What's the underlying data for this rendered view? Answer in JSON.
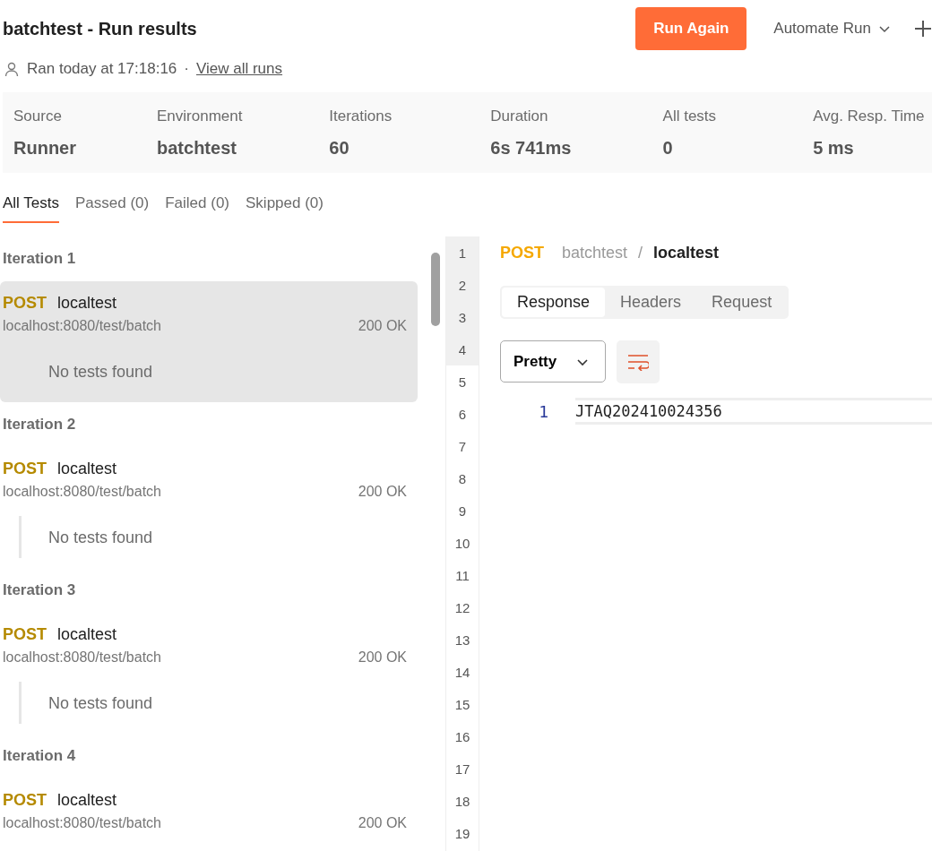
{
  "header": {
    "title": "batchtest - Run results",
    "run_again": "Run Again",
    "automate_run": "Automate Run",
    "ran_at": "Ran today at 17:18:16",
    "separator": "·",
    "view_all_runs": "View all runs"
  },
  "stats": [
    {
      "label": "Source",
      "value": "Runner"
    },
    {
      "label": "Environment",
      "value": "batchtest"
    },
    {
      "label": "Iterations",
      "value": "60"
    },
    {
      "label": "Duration",
      "value": "6s 741ms"
    },
    {
      "label": "All tests",
      "value": "0"
    },
    {
      "label": "Avg. Resp. Time",
      "value": "5 ms"
    }
  ],
  "tabs": [
    {
      "label": "All Tests",
      "selected": true
    },
    {
      "label": "Passed (0)",
      "selected": false
    },
    {
      "label": "Failed (0)",
      "selected": false
    },
    {
      "label": "Skipped (0)",
      "selected": false
    }
  ],
  "iterations": [
    {
      "title": "Iteration 1",
      "selected": true,
      "method": "POST",
      "name": "localtest",
      "url": "localhost:8080/test/batch",
      "status": "200 OK",
      "tests": "No tests found"
    },
    {
      "title": "Iteration 2",
      "selected": false,
      "method": "POST",
      "name": "localtest",
      "url": "localhost:8080/test/batch",
      "status": "200 OK",
      "tests": "No tests found"
    },
    {
      "title": "Iteration 3",
      "selected": false,
      "method": "POST",
      "name": "localtest",
      "url": "localhost:8080/test/batch",
      "status": "200 OK",
      "tests": "No tests found"
    },
    {
      "title": "Iteration 4",
      "selected": false,
      "method": "POST",
      "name": "localtest",
      "url": "localhost:8080/test/batch",
      "status": "200 OK"
    }
  ],
  "iteration_markers": [
    {
      "label": "1",
      "selected": true
    },
    {
      "label": "2",
      "selected": true
    },
    {
      "label": "3",
      "selected": true
    },
    {
      "label": "4",
      "selected": true
    },
    {
      "label": "5",
      "selected": false
    },
    {
      "label": "6",
      "selected": false
    },
    {
      "label": "7",
      "selected": false
    },
    {
      "label": "8",
      "selected": false
    },
    {
      "label": "9",
      "selected": false
    },
    {
      "label": "10",
      "selected": false
    },
    {
      "label": "11",
      "selected": false
    },
    {
      "label": "12",
      "selected": false
    },
    {
      "label": "13",
      "selected": false
    },
    {
      "label": "14",
      "selected": false
    },
    {
      "label": "15",
      "selected": false
    },
    {
      "label": "16",
      "selected": false
    },
    {
      "label": "17",
      "selected": false
    },
    {
      "label": "18",
      "selected": false
    },
    {
      "label": "19",
      "selected": false
    }
  ],
  "detail": {
    "method": "POST",
    "collection": "batchtest",
    "separator": "/",
    "request": "localtest",
    "tabs": [
      {
        "label": "Response",
        "selected": true
      },
      {
        "label": "Headers",
        "selected": false
      },
      {
        "label": "Request",
        "selected": false
      }
    ],
    "format": "Pretty",
    "code_lines": [
      {
        "number": "1",
        "text": "JTAQ202410024356"
      }
    ]
  }
}
